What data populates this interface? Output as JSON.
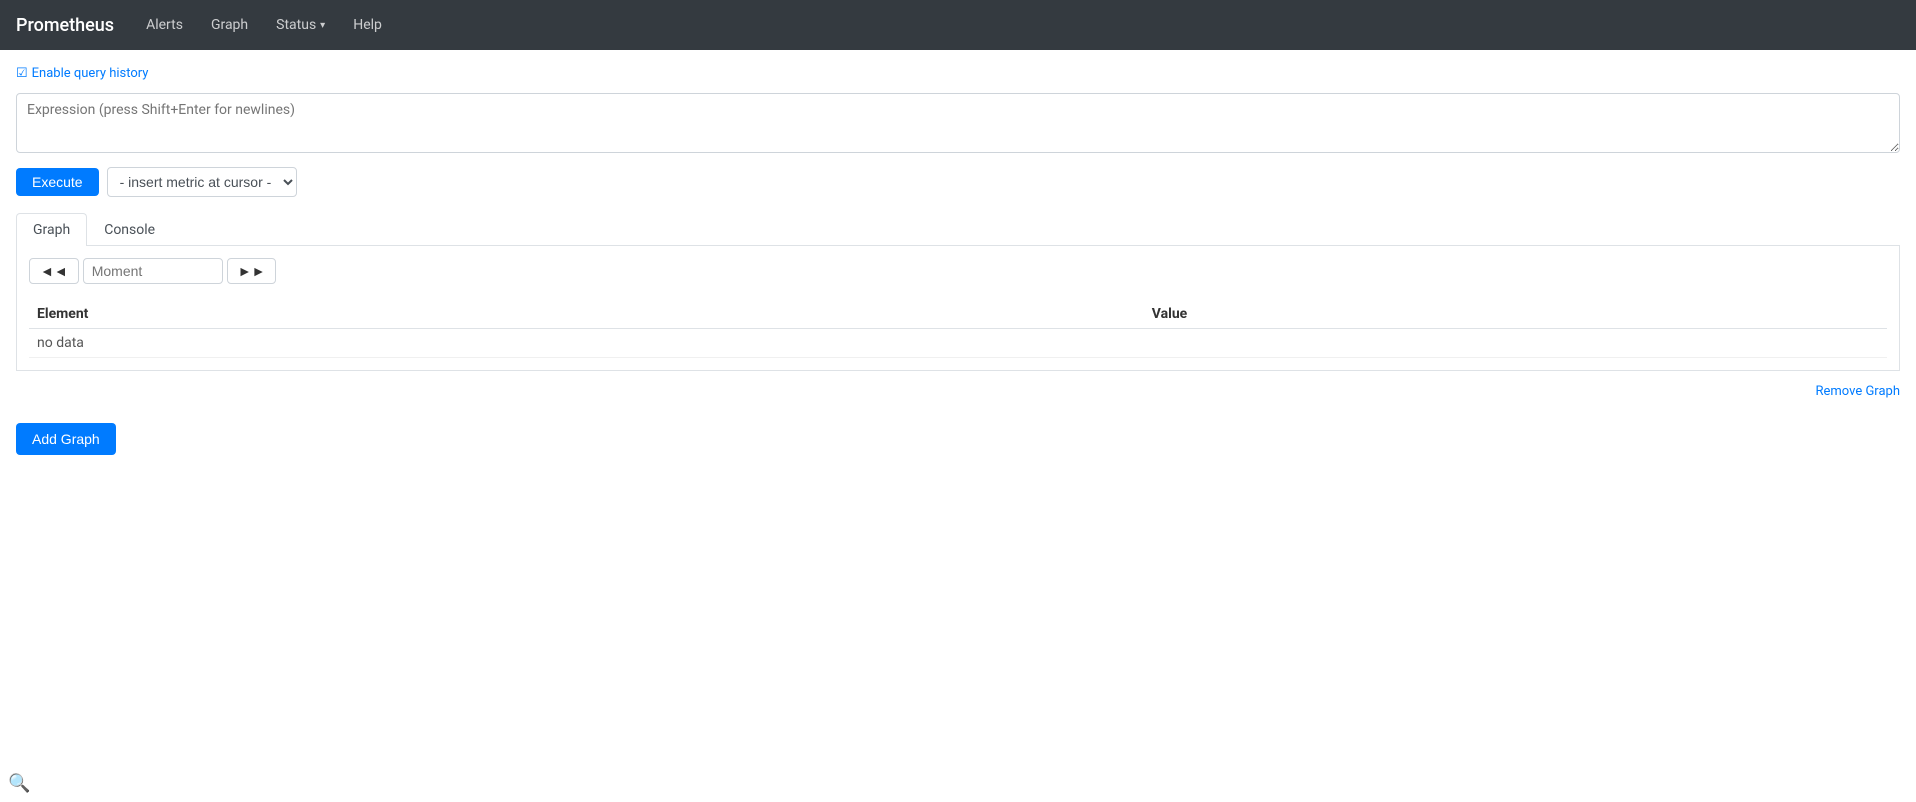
{
  "navbar": {
    "brand": "Prometheus",
    "links": [
      {
        "label": "Alerts",
        "id": "alerts"
      },
      {
        "label": "Graph",
        "id": "graph"
      },
      {
        "label": "Status",
        "id": "status",
        "dropdown": true
      },
      {
        "label": "Help",
        "id": "help"
      }
    ]
  },
  "querySection": {
    "enableHistoryLabel": "Enable query history",
    "expressionPlaceholder": "Expression (press Shift+Enter for newlines)",
    "executeLabel": "Execute",
    "metricSelectDefault": "- insert metric at cursor -"
  },
  "tabs": [
    {
      "id": "graph",
      "label": "Graph",
      "active": true
    },
    {
      "id": "console",
      "label": "Console",
      "active": false
    }
  ],
  "graphPanel": {
    "prevLabel": "◄◄",
    "nextLabel": "►►",
    "momentPlaceholder": "Moment",
    "tableHeaders": {
      "element": "Element",
      "value": "Value"
    },
    "noData": "no data",
    "removeGraphLabel": "Remove Graph",
    "addGraphLabel": "Add Graph"
  }
}
